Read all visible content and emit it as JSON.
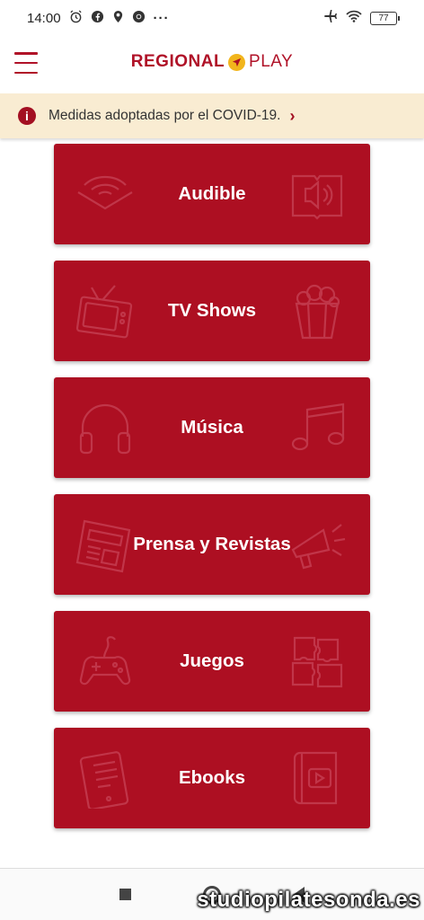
{
  "status_bar": {
    "time": "14:00",
    "left_icons": [
      "alarm-icon",
      "facebook-icon",
      "location-icon",
      "chrome-icon",
      "more-dots-icon"
    ],
    "more": "···",
    "right_icons": [
      "airplane-icon",
      "wifi-icon",
      "battery-icon"
    ],
    "battery": "77"
  },
  "header": {
    "logo_regional": "REGIONAL",
    "logo_play": "PLAY",
    "menu_icon": "hamburger-icon"
  },
  "notice": {
    "icon": "info-icon",
    "icon_glyph": "i",
    "text": "Medidas adoptadas por el COVID-19.",
    "chevron": "›"
  },
  "cards": [
    {
      "label": "Audible",
      "left_icon": "audible-logo-icon",
      "right_icon": "audiobook-icon"
    },
    {
      "label": "TV Shows",
      "left_icon": "tv-icon",
      "right_icon": "popcorn-icon"
    },
    {
      "label": "Música",
      "left_icon": "headphones-icon",
      "right_icon": "music-note-icon"
    },
    {
      "label": "Prensa y Revistas",
      "left_icon": "newspaper-icon",
      "right_icon": "megaphone-icon"
    },
    {
      "label": "Juegos",
      "left_icon": "gamepad-icon",
      "right_icon": "puzzle-icon"
    },
    {
      "label": "Ebooks",
      "left_icon": "ereader-icon",
      "right_icon": "video-book-icon"
    }
  ],
  "nav_bar": {
    "icons": [
      "recent-apps-icon",
      "home-icon",
      "back-icon"
    ]
  },
  "watermark": "studiopilatesonda.es",
  "colors": {
    "brand_red": "#ad0f22",
    "notice_bg": "#f9ecd2",
    "logo_yellow": "#f2b51c"
  }
}
